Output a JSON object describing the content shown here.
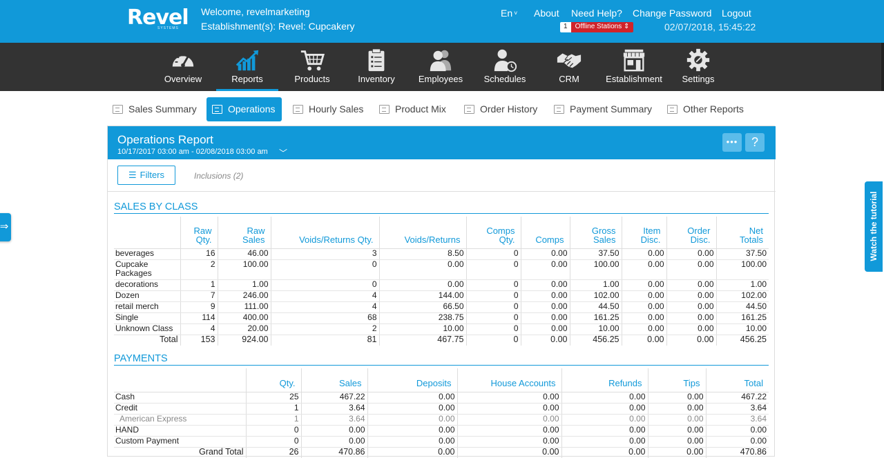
{
  "header": {
    "logo": "Revel",
    "logo_sub": "SYSTEMS",
    "welcome": "Welcome, revelmarketing",
    "establishment": "Establishment(s): Revel: Cupcakery",
    "language": "En",
    "links": {
      "about": "About",
      "help": "Need Help?",
      "password": "Change Password",
      "logout": "Logout"
    },
    "offline_count": "1",
    "offline_label": "Offline Stations",
    "datetime": "02/07/2018, 15:45:22"
  },
  "nav": {
    "items": [
      {
        "label": "Overview",
        "icon": "gauge-icon"
      },
      {
        "label": "Reports",
        "icon": "chart-icon"
      },
      {
        "label": "Products",
        "icon": "cart-icon"
      },
      {
        "label": "Inventory",
        "icon": "clipboard-icon"
      },
      {
        "label": "Employees",
        "icon": "people-icon"
      },
      {
        "label": "Schedules",
        "icon": "clock-person-icon"
      },
      {
        "label": "CRM",
        "icon": "handshake-icon"
      },
      {
        "label": "Establishment",
        "icon": "store-icon"
      },
      {
        "label": "Settings",
        "icon": "gear-icon"
      }
    ],
    "active": "Reports"
  },
  "subtabs": {
    "items": [
      "Sales Summary",
      "Operations",
      "Hourly Sales",
      "Product Mix",
      "Order History",
      "Payment Summary",
      "Other Reports"
    ],
    "active": "Operations"
  },
  "report": {
    "title": "Operations Report",
    "range": "10/17/2017 03:00 am - 02/08/2018 03:00 am",
    "more_btn": "•••",
    "help_btn": "?",
    "filters_label": "Filters",
    "inclusions_label": "Inclusions (2)"
  },
  "sales_by_class": {
    "title": "SALES BY CLASS",
    "columns": [
      "",
      "Raw\nQty.",
      "Raw\nSales",
      "Voids/Returns Qty.",
      "Voids/Returns",
      "Comps\nQty.",
      "Comps",
      "Gross\nSales",
      "Item\nDisc.",
      "Order\nDisc.",
      "Net\nTotals"
    ],
    "rows": [
      [
        "beverages",
        "16",
        "46.00",
        "3",
        "8.50",
        "0",
        "0.00",
        "37.50",
        "0.00",
        "0.00",
        "37.50"
      ],
      [
        "Cupcake Packages",
        "2",
        "100.00",
        "0",
        "0.00",
        "0",
        "0.00",
        "100.00",
        "0.00",
        "0.00",
        "100.00"
      ],
      [
        "decorations",
        "1",
        "1.00",
        "0",
        "0.00",
        "0",
        "0.00",
        "1.00",
        "0.00",
        "0.00",
        "1.00"
      ],
      [
        "Dozen",
        "7",
        "246.00",
        "4",
        "144.00",
        "0",
        "0.00",
        "102.00",
        "0.00",
        "0.00",
        "102.00"
      ],
      [
        "retail merch",
        "9",
        "111.00",
        "4",
        "66.50",
        "0",
        "0.00",
        "44.50",
        "0.00",
        "0.00",
        "44.50"
      ],
      [
        "Single",
        "114",
        "400.00",
        "68",
        "238.75",
        "0",
        "0.00",
        "161.25",
        "0.00",
        "0.00",
        "161.25"
      ],
      [
        "Unknown Class",
        "4",
        "20.00",
        "2",
        "10.00",
        "0",
        "0.00",
        "10.00",
        "0.00",
        "0.00",
        "10.00"
      ]
    ],
    "total": [
      "Total",
      "153",
      "924.00",
      "81",
      "467.75",
      "0",
      "0.00",
      "456.25",
      "0.00",
      "0.00",
      "456.25"
    ]
  },
  "payments": {
    "title": "PAYMENTS",
    "columns": [
      "",
      "Qty.",
      "Sales",
      "Deposits",
      "House Accounts",
      "Refunds",
      "Tips",
      "Total"
    ],
    "rows": [
      {
        "cells": [
          "Cash",
          "25",
          "467.22",
          "0.00",
          "0.00",
          "0.00",
          "0.00",
          "467.22"
        ],
        "sub": false
      },
      {
        "cells": [
          "Credit",
          "1",
          "3.64",
          "0.00",
          "0.00",
          "0.00",
          "0.00",
          "3.64"
        ],
        "sub": false
      },
      {
        "cells": [
          "American Express",
          "1",
          "3.64",
          "0.00",
          "0.00",
          "0.00",
          "0.00",
          "3.64"
        ],
        "sub": true
      },
      {
        "cells": [
          "HAND",
          "0",
          "0.00",
          "0.00",
          "0.00",
          "0.00",
          "0.00",
          "0.00"
        ],
        "sub": false
      },
      {
        "cells": [
          "Custom Payment",
          "0",
          "0.00",
          "0.00",
          "0.00",
          "0.00",
          "0.00",
          "0.00"
        ],
        "sub": false
      }
    ],
    "total": [
      "Grand Total",
      "26",
      "470.86",
      "0.00",
      "0.00",
      "0.00",
      "0.00",
      "470.86"
    ]
  },
  "side": {
    "toggle": "⇒",
    "tutorial": "Watch the tutorial"
  }
}
